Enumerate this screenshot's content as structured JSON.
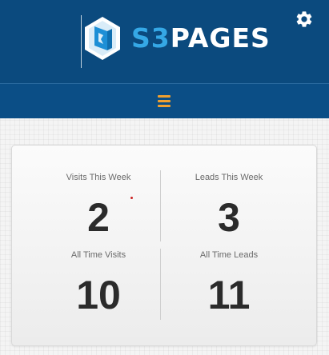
{
  "header": {
    "logo": {
      "prefix": "S3",
      "suffix": "PAGES"
    },
    "settings_icon": "gear-icon"
  },
  "nav": {
    "menu_icon": "hamburger-menu-icon"
  },
  "colors": {
    "header_bg": "#0b4a7e",
    "nav_bg": "#0b4e86",
    "logo_accent": "#35a8e6",
    "menu_icon": "#f0a030",
    "stat_value": "#2b2b2b"
  },
  "stats": [
    {
      "label": "Visits This Week",
      "value": "2"
    },
    {
      "label": "Leads This Week",
      "value": "3"
    },
    {
      "label": "All Time Visits",
      "value": "10"
    },
    {
      "label": "All Time Leads",
      "value": "11"
    }
  ]
}
